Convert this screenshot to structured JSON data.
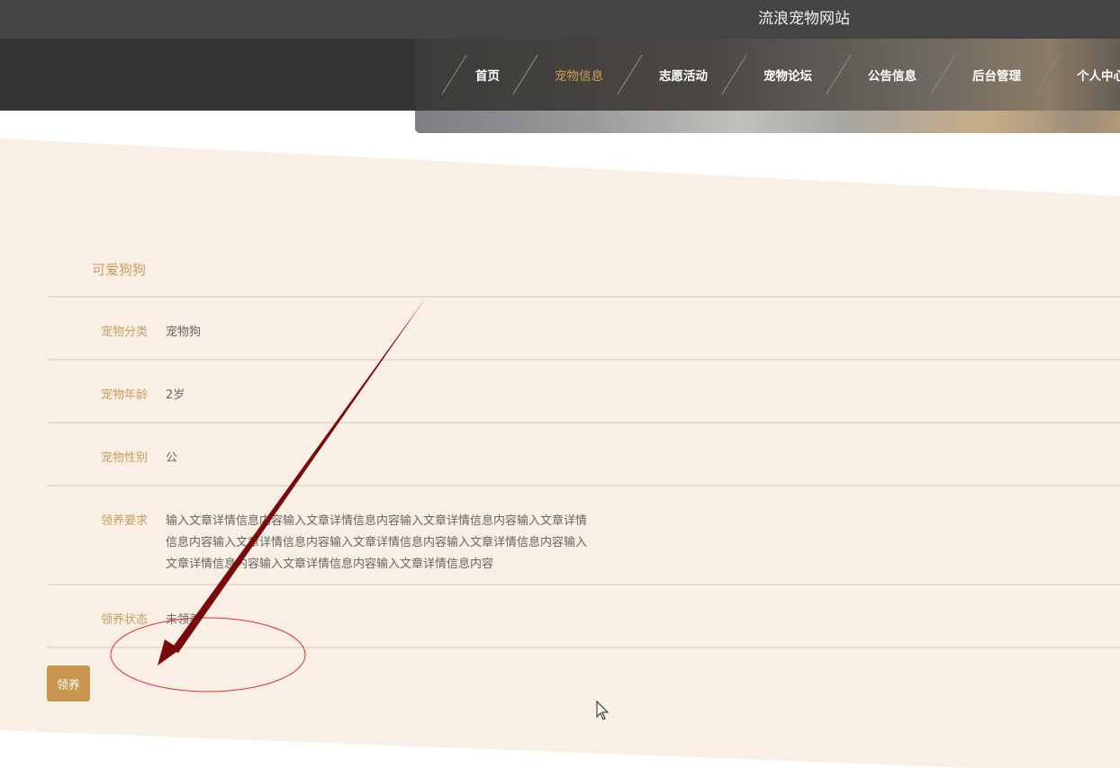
{
  "header": {
    "site_title": "流浪宠物网站"
  },
  "nav": {
    "items": [
      {
        "label": "首页",
        "active": false
      },
      {
        "label": "宠物信息",
        "active": true
      },
      {
        "label": "志愿活动",
        "active": false
      },
      {
        "label": "宠物论坛",
        "active": false
      },
      {
        "label": "公告信息",
        "active": false
      },
      {
        "label": "后台管理",
        "active": false
      },
      {
        "label": "个人中心",
        "active": false
      }
    ]
  },
  "detail": {
    "title": "可爱狗狗",
    "fields": [
      {
        "label": "宠物分类",
        "value": "宠物狗"
      },
      {
        "label": "宠物年龄",
        "value": "2岁"
      },
      {
        "label": "宠物性别",
        "value": "公"
      },
      {
        "label": "领养要求",
        "value": "输入文章详情信息内容输入文章详情信息内容输入文章详情信息内容输入文章详情信息内容输入文章详情信息内容输入文章详情信息内容输入文章详情信息内容输入文章详情信息内容输入文章详情信息内容输入文章详情信息内容"
      },
      {
        "label": "领养状态",
        "value": "未领养"
      }
    ],
    "adopt_button_label": "领养"
  },
  "colors": {
    "accent": "#c99d5e",
    "button": "#c8964e",
    "panel_bg": "#f9efe4",
    "title_bar": "#444444",
    "nav_bar": "#353535",
    "annotation_arrow": "#7a0a0a",
    "annotation_ellipse": "#e03030"
  }
}
